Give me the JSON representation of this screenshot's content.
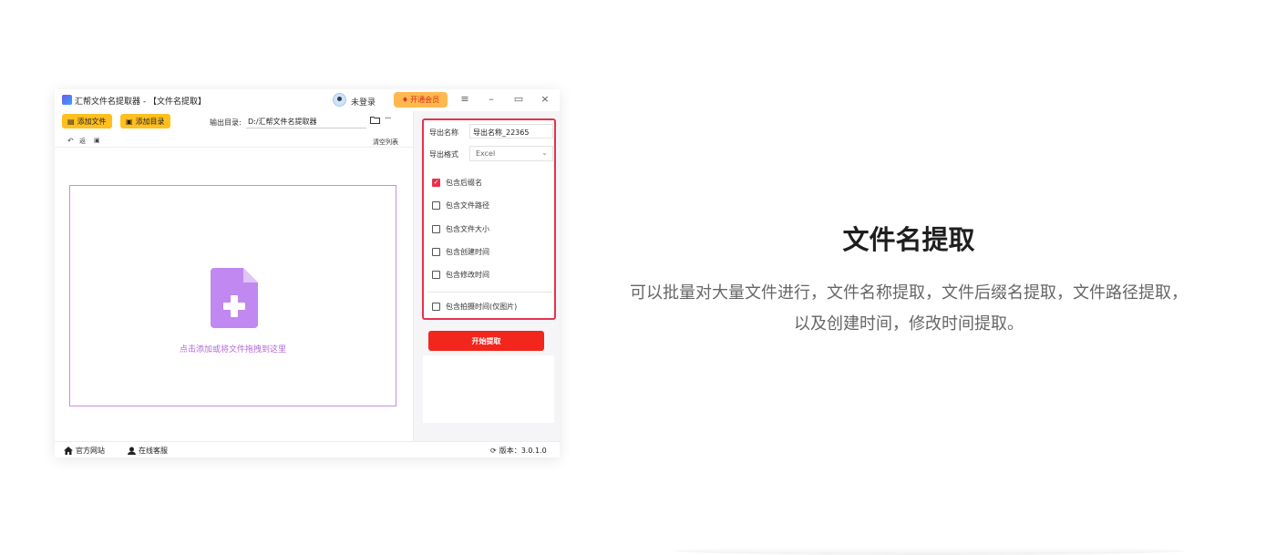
{
  "window": {
    "title": "汇帮文件名提取器 - 【文件名提取】",
    "user_status": "未登录",
    "vip_label": "开通会员",
    "controls": {
      "menu": "≡",
      "minimize": "–",
      "maximize": "▭",
      "close": "×"
    }
  },
  "toolbar": {
    "add_file_label": "添加文件",
    "add_folder_label": "添加目录",
    "output_dir_label": "输出目录:",
    "output_dir_value": "D:/汇帮文件名提取器",
    "more": "···"
  },
  "subbar": {
    "back_label": "返",
    "clear_list_label": "清空列表"
  },
  "dropzone": {
    "hint": "点击添加或将文件拖拽到这里"
  },
  "settings": {
    "export_name_label": "导出名称",
    "export_name_value": "导出名称_22365",
    "export_format_label": "导出格式",
    "export_format_value": "Excel",
    "options": [
      {
        "label": "包含后缀名",
        "checked": true
      },
      {
        "label": "包含文件路径",
        "checked": false
      },
      {
        "label": "包含文件大小",
        "checked": false
      },
      {
        "label": "包含创建时间",
        "checked": false
      },
      {
        "label": "包含修改时间",
        "checked": false
      }
    ],
    "photo_option": {
      "label": "包含拍摄时间(仅图片)",
      "checked": false
    },
    "start_label": "开始提取"
  },
  "statusbar": {
    "website_label": "官方网站",
    "support_label": "在线客服",
    "version_label": "版本：3.0.1.0"
  },
  "feature": {
    "title": "文件名提取",
    "description": "可以批量对大量文件进行，文件名称提取，文件后缀名提取，文件路径提取，以及创建时间，修改时间提取。"
  },
  "colors": {
    "accent_red": "#e8314b",
    "button_yellow": "#ffbf1f",
    "start_red": "#f2261c",
    "dropzone_purple": "#c088f0"
  },
  "icons": [
    "app-logo-icon",
    "user-avatar-icon",
    "vip-gem-icon",
    "add-file-icon",
    "add-folder-icon",
    "folder-icon",
    "more-icon",
    "back-icon",
    "grid-icon",
    "file-add-icon",
    "home-icon",
    "support-icon",
    "refresh-icon",
    "checkmark-icon"
  ]
}
